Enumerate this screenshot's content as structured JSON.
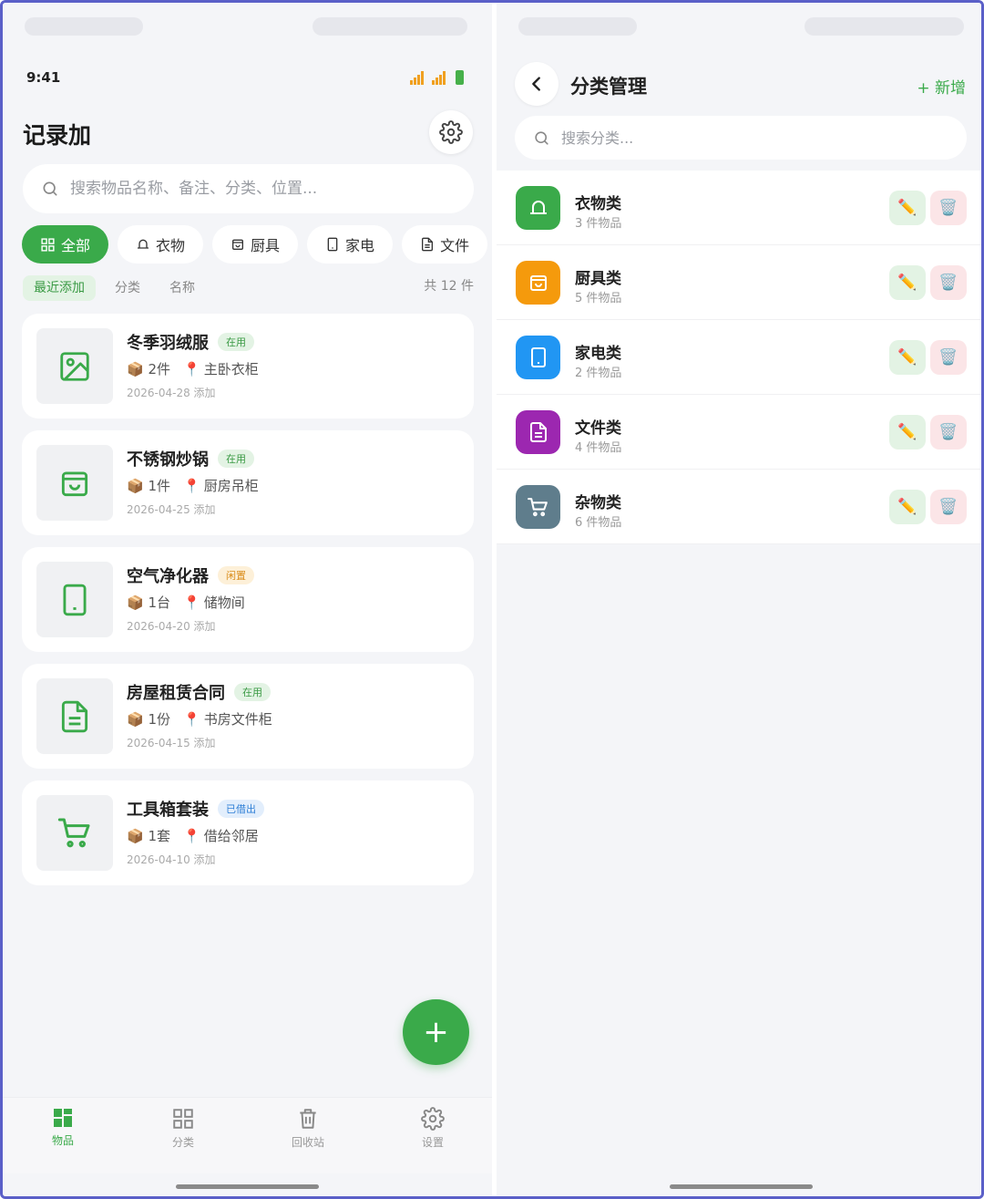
{
  "colors": {
    "accent": "#3aaa4a",
    "frame": "#5a5fc8"
  },
  "left": {
    "status": {
      "time": "9:41"
    },
    "app_title": "记录加",
    "search_placeholder": "搜索物品名称、备注、分类、位置...",
    "chips": [
      {
        "label": "全部",
        "icon": "grid-icon"
      },
      {
        "label": "衣物",
        "icon": "bell-icon"
      },
      {
        "label": "厨具",
        "icon": "bag-icon"
      },
      {
        "label": "家电",
        "icon": "tablet-icon"
      },
      {
        "label": "文件",
        "icon": "document-icon"
      }
    ],
    "sort": {
      "recent": "最近添加",
      "category": "分类",
      "name": "名称",
      "total": "共 12 件"
    },
    "items": [
      {
        "name": "冬季羽绒服",
        "status": "在用",
        "qty": "2件",
        "location": "主卧衣柜",
        "date": "2026-04-28 添加",
        "icon": "image-icon"
      },
      {
        "name": "不锈钢炒锅",
        "status": "在用",
        "qty": "1件",
        "location": "厨房吊柜",
        "date": "2026-04-25 添加",
        "icon": "bag-icon"
      },
      {
        "name": "空气净化器",
        "status": "闲置",
        "qty": "1台",
        "location": "储物间",
        "date": "2026-04-20 添加",
        "icon": "tablet-icon"
      },
      {
        "name": "房屋租赁合同",
        "status": "在用",
        "qty": "1份",
        "location": "书房文件柜",
        "date": "2026-04-15 添加",
        "icon": "document-icon"
      },
      {
        "name": "工具箱套装",
        "status": "已借出",
        "qty": "1套",
        "location": "借给邻居",
        "date": "2026-04-10 添加",
        "icon": "cart-icon"
      }
    ],
    "fab_label": "+",
    "tabs": [
      {
        "label": "物品",
        "icon": "items-icon"
      },
      {
        "label": "分类",
        "icon": "category-icon"
      },
      {
        "label": "回收站",
        "icon": "trash-icon"
      },
      {
        "label": "设置",
        "icon": "gear-icon"
      }
    ]
  },
  "right": {
    "title": "分类管理",
    "add_label": "+ 新增",
    "search_placeholder": "搜索分类...",
    "categories": [
      {
        "name": "衣物类",
        "count": "3 件物品",
        "color": "#3aaa4a",
        "icon": "bell-icon"
      },
      {
        "name": "厨具类",
        "count": "5 件物品",
        "color": "#f59a0c",
        "icon": "bag-icon"
      },
      {
        "name": "家电类",
        "count": "2 件物品",
        "color": "#2196f3",
        "icon": "tablet-icon"
      },
      {
        "name": "文件类",
        "count": "4 件物品",
        "color": "#9c27b0",
        "icon": "document-icon"
      },
      {
        "name": "杂物类",
        "count": "6 件物品",
        "color": "#5f7d8c",
        "icon": "cart-icon"
      }
    ],
    "edit_glyph": "✏️",
    "delete_glyph": "🗑️"
  }
}
